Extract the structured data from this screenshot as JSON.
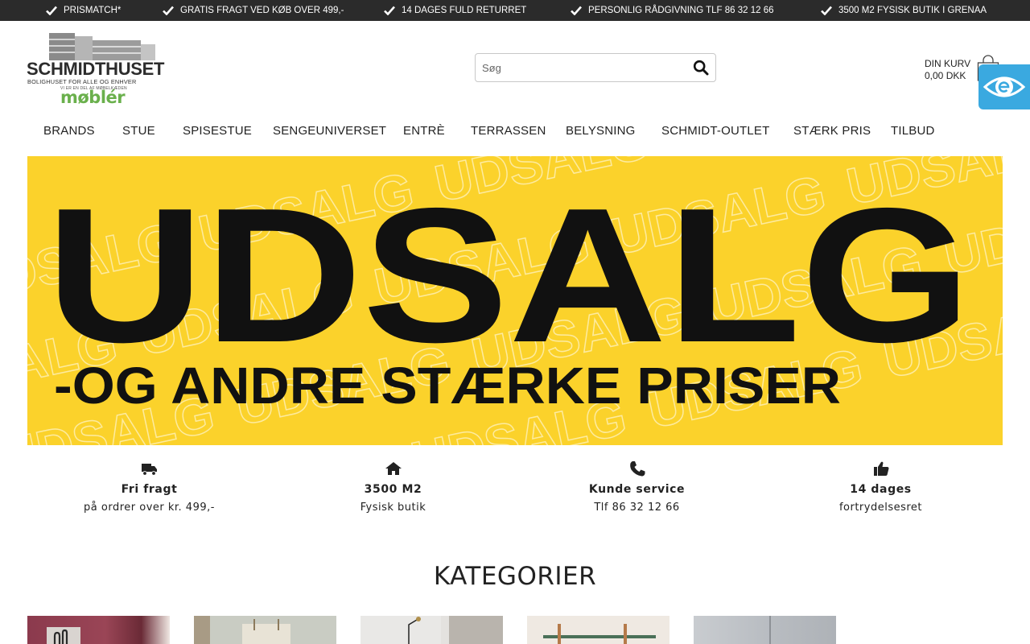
{
  "topbar": {
    "items": [
      "PRISMATCH*",
      "GRATIS FRAGT VED KØB OVER 499,-",
      "14 DAGES FULD RETURRET",
      "PERSONLIG RÅDGIVNING TLF 86 32 12 66",
      "3500 M2 FYSISK BUTIK I GRENAA"
    ]
  },
  "logo": {
    "name": "SCHMIDTHUSET",
    "tagline": "BOLIGHUSET FOR ALLE OG ENHVER",
    "chain": "VI ER EN DEL AF MØBELKÆDEN",
    "partner": "møblér"
  },
  "search": {
    "placeholder": "Søg",
    "icon": "search-icon"
  },
  "cart": {
    "label": "DIN KURV",
    "amount": "0,00",
    "currency": "DKK",
    "icon": "shopping-bag-icon"
  },
  "accessibility": {
    "icon": "eye-icon",
    "color": "#3aa9e0"
  },
  "nav": {
    "items": [
      "BRANDS",
      "STUE",
      "SPISESTUE",
      "SENGEUNIVERSET",
      "ENTRÈ",
      "TERRASSEN",
      "BELYSNING",
      "SCHMIDT-OUTLET",
      "STÆRK PRIS",
      "TILBUD"
    ]
  },
  "hero": {
    "headline": "UDSALG",
    "subline": "-OG ANDRE STÆRKE PRISER",
    "background_color": "#fbd22b"
  },
  "usps": [
    {
      "icon": "truck-icon",
      "title": "Fri fragt",
      "sub": "på ordrer over kr. 499,-"
    },
    {
      "icon": "home-icon",
      "title": "3500 M2",
      "sub": "Fysisk butik"
    },
    {
      "icon": "phone-icon",
      "title": "Kunde service",
      "sub": "Tlf 86 32 12 66"
    },
    {
      "icon": "thumbs-up-icon",
      "title": "14 dages",
      "sub": "fortrydelsesret"
    }
  ],
  "categories": {
    "heading": "KATEGORIER"
  },
  "colors": {
    "topbar": "#2b2b2b",
    "text": "#222222",
    "accent_green": "#6ab04c"
  }
}
